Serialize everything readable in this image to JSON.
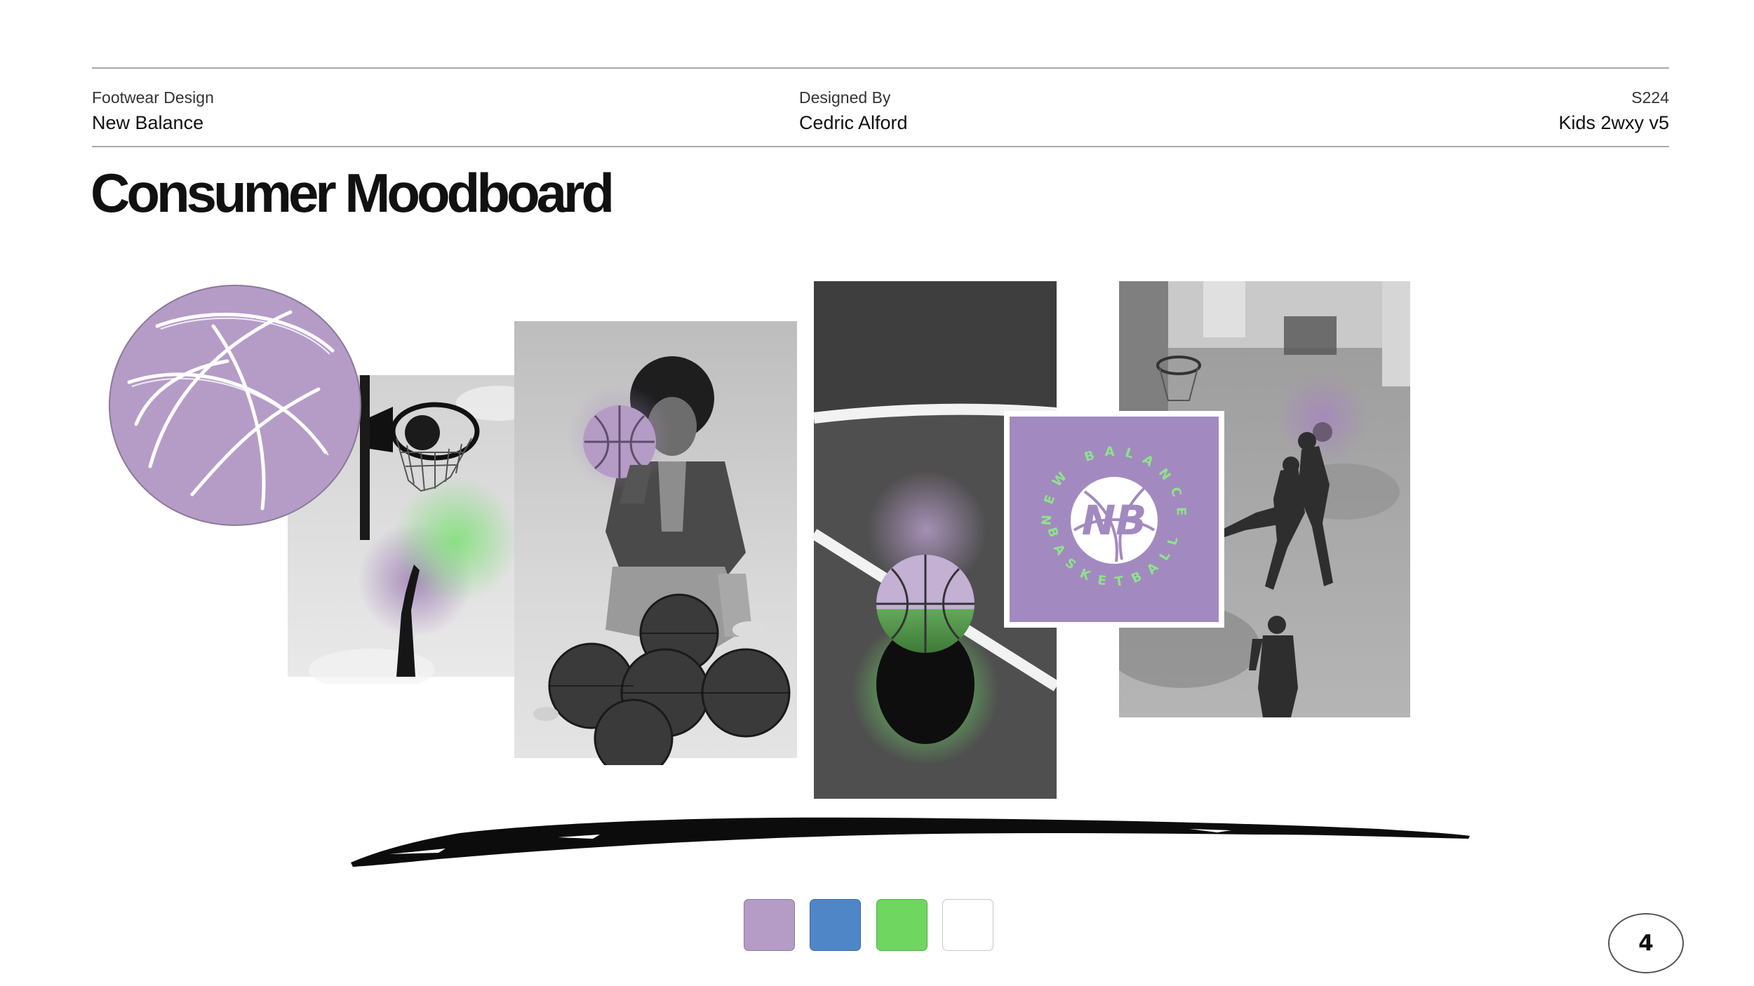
{
  "header": {
    "left_label": "Footwear Design",
    "left_value": "New Balance",
    "center_label": "Designed By",
    "center_value": "Cedric Alford",
    "right_label": "S224",
    "right_value": "Kids 2wxy v5"
  },
  "title": "Consumer Moodboard",
  "logo": {
    "ring_top": "NEW BALANCE",
    "ring_bottom": "BASKETBALL"
  },
  "images": [
    {
      "name": "purple-basketball-graphic"
    },
    {
      "name": "hoop-and-hand-photo"
    },
    {
      "name": "kid-with-basketballs-photo"
    },
    {
      "name": "court-ball-shadow-photo"
    },
    {
      "name": "new-balance-basketball-logo"
    },
    {
      "name": "street-basketball-photo"
    }
  ],
  "palette": {
    "colors": [
      "#b59cc7",
      "#4f86c8",
      "#6fd65f",
      "#ffffff"
    ]
  },
  "page_number": "4"
}
